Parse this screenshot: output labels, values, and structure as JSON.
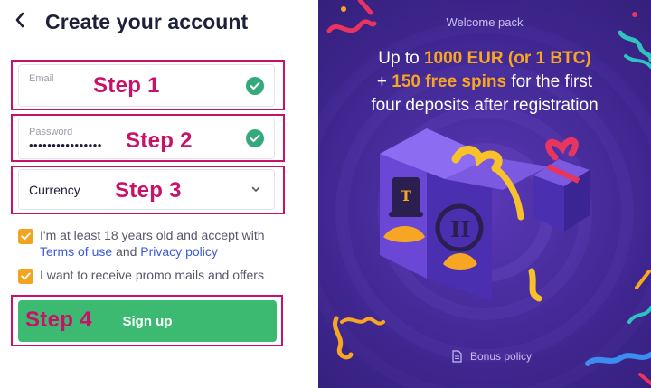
{
  "header": {
    "back_icon": "chevron-left-icon",
    "title": "Create your account"
  },
  "form": {
    "email": {
      "label": "Email",
      "value": ""
    },
    "password": {
      "label": "Password",
      "value": "••••••••••••••••"
    },
    "currency": {
      "label": "Currency"
    },
    "age_check": {
      "checked": true,
      "text_before": "I'm at least 18 years old and accept with",
      "terms_link": "Terms of use",
      "conjunction": "and",
      "privacy_link": "Privacy policy"
    },
    "promo_check": {
      "checked": true,
      "text": "I want to receive promo mails and offers"
    },
    "submit_label": "Sign up"
  },
  "annotations": {
    "color": "#c8126a",
    "steps": [
      "Step 1",
      "Step 2",
      "Step 3",
      "Step 4"
    ]
  },
  "promo": {
    "welcome": "Welcome pack",
    "line1_prefix": "Up to ",
    "line1_highlight": "1000 EUR (or 1 BTC)",
    "line2_prefix": "+ ",
    "line2_highlight": "150 free spins",
    "line2_suffix": " for the first",
    "line3": "four deposits after registration",
    "bonus_policy": "Bonus policy"
  },
  "colors": {
    "accent_orange": "#f6a623",
    "checkbox": "#f2a41e",
    "submit": "#3dba72",
    "valid": "#34a97a",
    "link": "#3b5bd9",
    "panel_bg": "#3d258c"
  }
}
